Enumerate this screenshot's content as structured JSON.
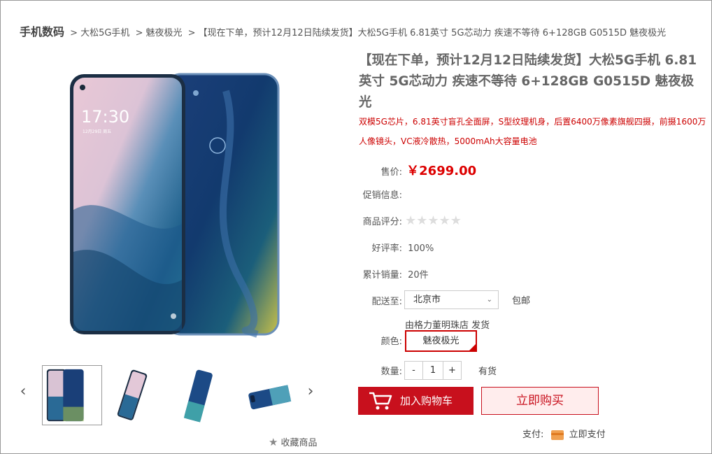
{
  "breadcrumb": {
    "root": "手机数码",
    "sep": ">",
    "level1": "大松5G手机",
    "level2": "魅夜极光",
    "current": "【现在下单，预计12月12日陆续发货】大松5G手机 6.81英寸 5G芯动力 疾速不等待 6+128GB G0515D 魅夜极光"
  },
  "product": {
    "title": "【现在下单，预计12月12日陆续发货】大松5G手机 6.81英寸 5G芯动力 疾速不等待 6+128GB G0515D 魅夜极光",
    "description": "双模5G芯片，6.81英寸盲孔全面屏，S型纹理机身，后置6400万像素旗舰四摄，前摄1600万人像镜头，VC液冷散热，5000mAh大容量电池",
    "screen_time": "17:30",
    "screen_date": "12月29日 周五"
  },
  "labels": {
    "price": "售价:",
    "promo": "促销信息:",
    "rating": "商品评分:",
    "good_rate": "好评率:",
    "sales": "累计销量:",
    "ship_to": "配送至:",
    "color": "颜色:",
    "qty": "数量:"
  },
  "values": {
    "price": "￥2699.00",
    "good_rate": "100%",
    "sales": "20件",
    "rating_stars": 0,
    "rating_max": 5
  },
  "shipping": {
    "city": "北京市",
    "free_shipping": "包邮",
    "shipper": "由格力董明珠店 发货"
  },
  "color_option": "魅夜极光",
  "quantity": {
    "minus": "-",
    "value": "1",
    "plus": "+",
    "stock": "有货"
  },
  "buttons": {
    "add_to_cart": "加入购物车",
    "buy_now": "立即购买"
  },
  "favorite": "收藏商品",
  "payment": {
    "label": "支付:",
    "link": "立即支付"
  },
  "colors": {
    "accent": "#c8101d",
    "price": "#dd0000",
    "buy_bg": "#ffeded"
  }
}
